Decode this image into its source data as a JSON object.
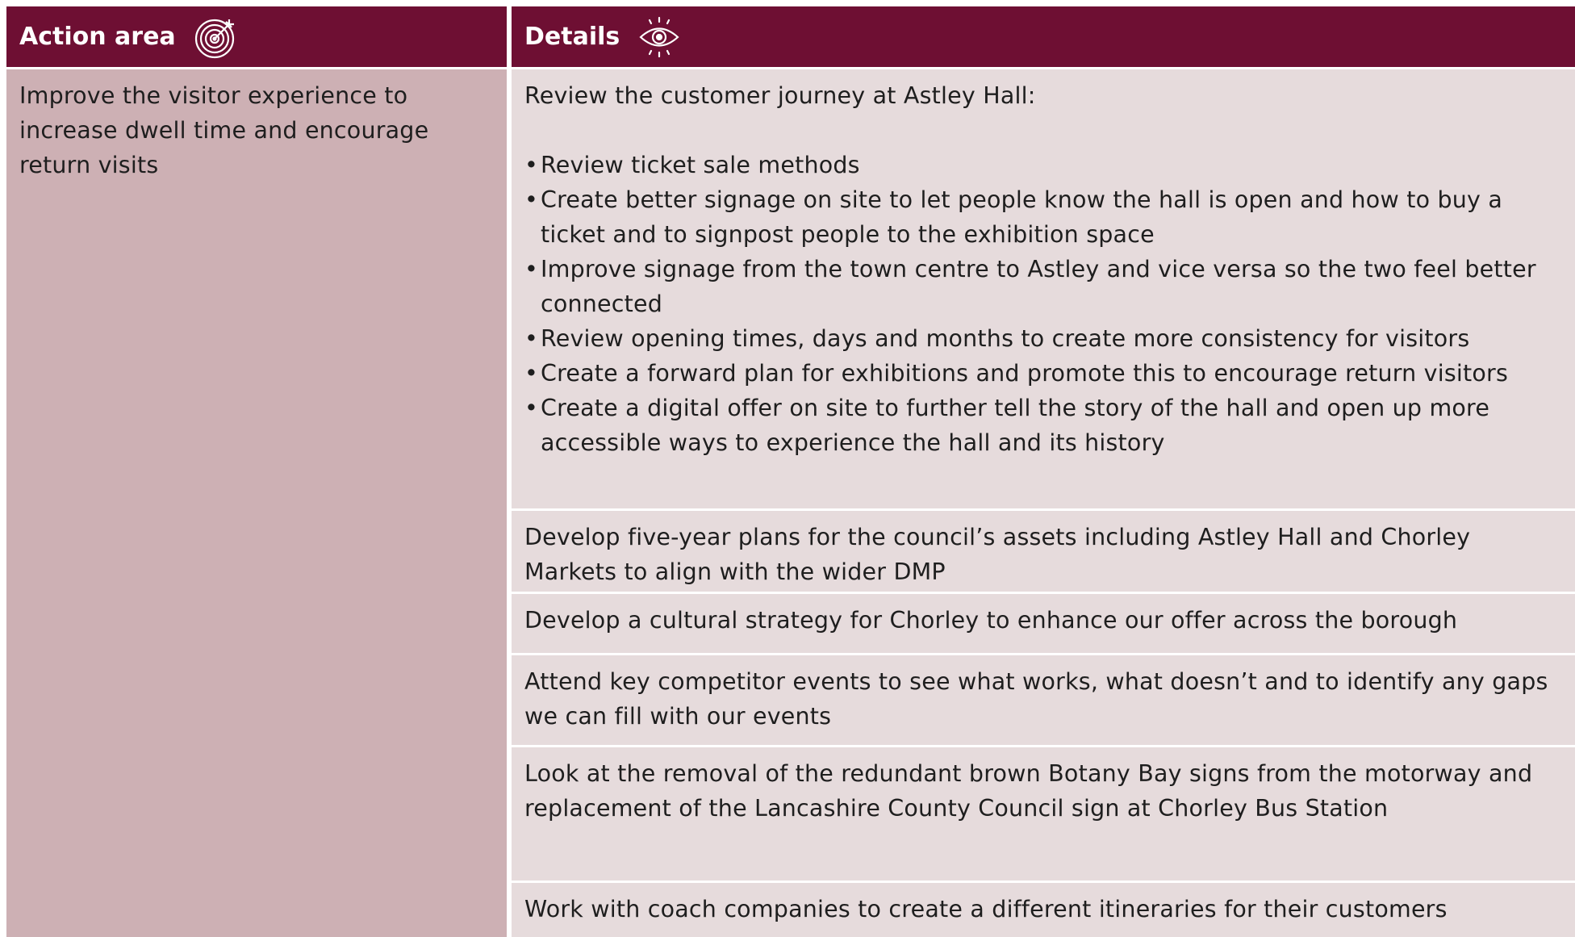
{
  "header": {
    "action_area_label": "Action area",
    "action_area_icon": "target-icon",
    "details_label": "Details",
    "details_icon": "eye-icon"
  },
  "colors": {
    "header_bg": "#6e0f33",
    "left_cell_bg": "#cdb0b4",
    "right_cell_bg": "#e6dbdc"
  },
  "action_area": {
    "text": "Improve the visitor experience to increase dwell time and encourage return visits"
  },
  "details": {
    "customer_journey": {
      "intro": "Review the customer journey at Astley Hall:",
      "bullets": [
        "Review ticket sale methods",
        "Create better signage on site to let people know the hall is open and how to buy a ticket and to signpost people to the exhibition space",
        "Improve signage from the town centre to Astley and vice versa so the two feel better connected",
        "Review opening times, days and months to create more consistency for visitors",
        "Create a forward plan for exhibitions and promote this to encourage return visitors",
        "Create a digital offer on site to further tell the story of the hall and open up more accessible ways to experience the hall and its history"
      ]
    },
    "five_year_plans": "Develop five-year plans for the council’s assets including Astley Hall and Chorley Markets to align with the wider DMP",
    "cultural_strategy": "Develop a cultural strategy for Chorley to enhance our offer across the borough",
    "competitor_events": "Attend key competitor events to see what works, what doesn’t and to identify any gaps we can fill with our events",
    "signage_removal": "Look at the removal of the redundant brown Botany Bay signs from the motorway and replacement of the Lancashire County Council sign at Chorley Bus Station",
    "coach_companies": "Work with coach companies to create a different itineraries for their customers"
  }
}
